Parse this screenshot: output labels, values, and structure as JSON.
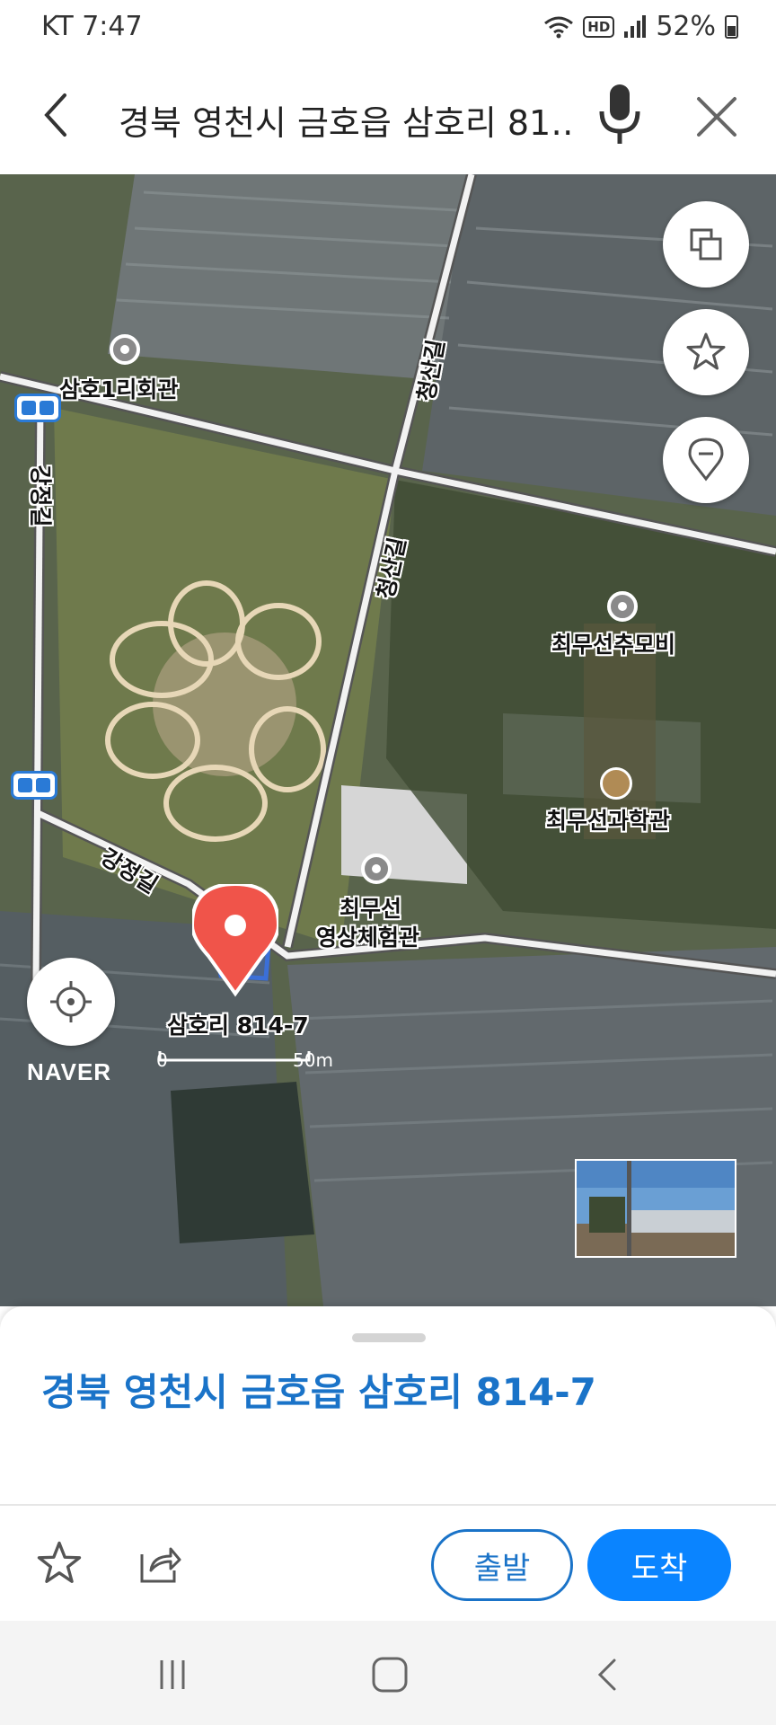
{
  "status_bar": {
    "carrier_time": "KT 7:47",
    "hd_label": "HD",
    "battery": "52%"
  },
  "search": {
    "query": "경북 영천시 금호읍 삼호리 81…",
    "back_icon": "chevron-left-icon",
    "mic_icon": "microphone-icon",
    "close_icon": "close-icon"
  },
  "map": {
    "labels": {
      "hall": "삼호1리회관",
      "road_cheongsan_1": "청산길",
      "road_cheongsan_2": "청산길",
      "road_gangjeong_1": "강정길",
      "road_gangjeong_2": "강정길",
      "monument": "최무선추모비",
      "science_hall": "최무선과학관",
      "video_hall_line1": "최무선",
      "video_hall_line2": "영상체험관",
      "pin_label": "삼호리 814-7"
    },
    "logo": "NAVER",
    "scale_start": "0",
    "scale_end": "50m",
    "buttons": {
      "layers_icon": "layers-icon",
      "favorite_icon": "star-icon",
      "pin_icon": "location-pin-icon",
      "locate_icon": "crosshair-icon"
    },
    "pin_color": "#f0544a"
  },
  "sheet": {
    "title": "경북 영천시 금호읍 삼호리 814-7",
    "depart_label": "출발",
    "arrive_label": "도착",
    "accent_color": "#1a73c8",
    "arrive_color": "#0a84ff"
  },
  "nav_bar": {
    "recent_icon": "recent-apps-icon",
    "home_icon": "home-icon",
    "back_icon": "back-icon"
  }
}
